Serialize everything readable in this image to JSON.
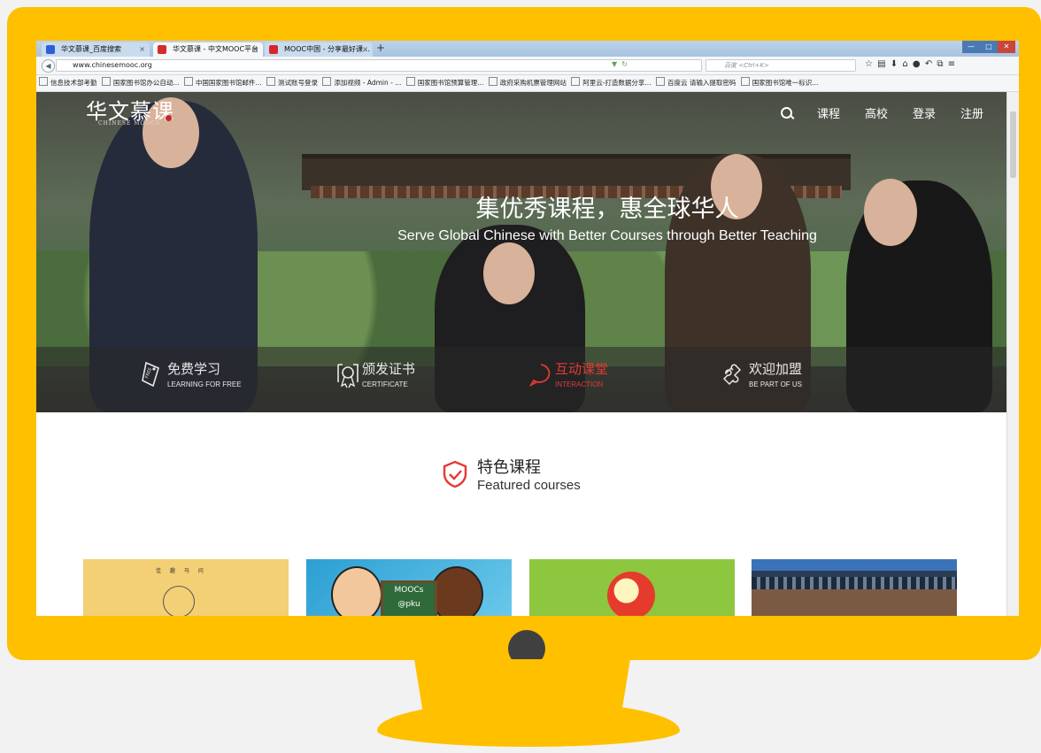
{
  "browser": {
    "tabs": [
      {
        "label": "华文慕课_百度搜索",
        "favicon_color": "#2d5fd8",
        "active": false
      },
      {
        "label": "华文慕课 - 中文MOOC平台",
        "favicon_color": "#d62b2b",
        "active": true
      },
      {
        "label": "MOOC中国 - 分享最好课...",
        "favicon_color": "#d6262d",
        "active": false
      }
    ],
    "new_tab_label": "+",
    "url": "www.chinesemooc.org",
    "search_placeholder": "百度 <Ctrl+K>",
    "window_buttons": {
      "minimize": "—",
      "maximize": "□",
      "close": "✕"
    },
    "bookmarks": [
      "信息技术部考勤",
      "国家图书馆办公自动...",
      "中国国家图书馆邮件...",
      "测试账号登录",
      "添加视频 - Admin - ...",
      "国家图书馆预算管理...",
      "政府采购机票管理网站",
      "阿里云-打造数据分享...",
      "百度云 请输入提取密码",
      "国家图书馆唯一标识..."
    ]
  },
  "site": {
    "logo_text": "华文慕课",
    "logo_sub": "CHINESE MOOCS",
    "nav": {
      "courses": "课程",
      "universities": "高校",
      "login": "登录",
      "register": "注册"
    },
    "hero": {
      "title": "集优秀课程，惠全球华人",
      "subtitle": "Serve Global Chinese with Better Courses through Better Teaching"
    },
    "features": [
      {
        "title": "免费学习",
        "sub": "LEARNING FOR FREE",
        "icon": "free-tag-icon",
        "highlight": false
      },
      {
        "title": "颁发证书",
        "sub": "CERTIFICATE",
        "icon": "certificate-icon",
        "highlight": false
      },
      {
        "title": "互动课堂",
        "sub": "INTERACTION",
        "icon": "chat-bubble-icon",
        "highlight": true
      },
      {
        "title": "欢迎加盟",
        "sub": "BE PART OF US",
        "icon": "puzzle-icon",
        "highlight": false
      }
    ],
    "section": {
      "title": "特色课程",
      "subtitle": "Featured courses",
      "icon": "shield-check-icon"
    },
    "cards": [
      {
        "caption": "佳 趣 马 问"
      },
      {
        "caption": "MOOCs @pku"
      },
      {
        "caption": ""
      },
      {
        "caption": ""
      }
    ],
    "colors": {
      "accent_red": "#e53935",
      "monitor_yellow": "#ffc000"
    }
  }
}
